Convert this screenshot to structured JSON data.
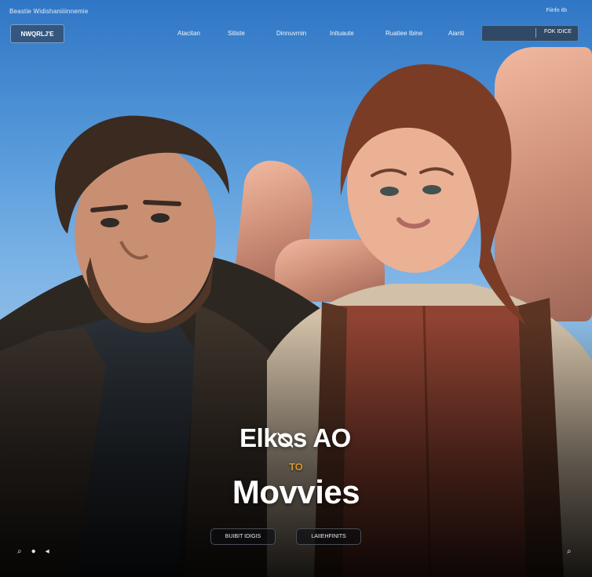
{
  "topbar": {
    "tagline": "Beastie Widishaniiiinnemie",
    "right_label": "Fiinfo itb"
  },
  "header": {
    "logo_text": "NWQRLJ'E",
    "nav": [
      "Atacitan",
      "Sitiste",
      "Dinnuvrnin",
      "Inituaute",
      "Ruatiee Ibine",
      "Aianti"
    ],
    "search_placeholder": "",
    "search_button": "FOK IDICE"
  },
  "hero": {
    "title_line1": "Elkᴓs AO",
    "title_line2": "TO",
    "title_line3": "Movvies",
    "cta_primary": "BUIBIT IDIGIS",
    "cta_secondary": "LAIIEHFINITS"
  },
  "footer_icons": {
    "left": [
      "search-icon",
      "user-icon",
      "arrow-icon"
    ],
    "right": "search-icon"
  },
  "colors": {
    "accent": "#d6962f",
    "button_bg": "#34577f"
  }
}
